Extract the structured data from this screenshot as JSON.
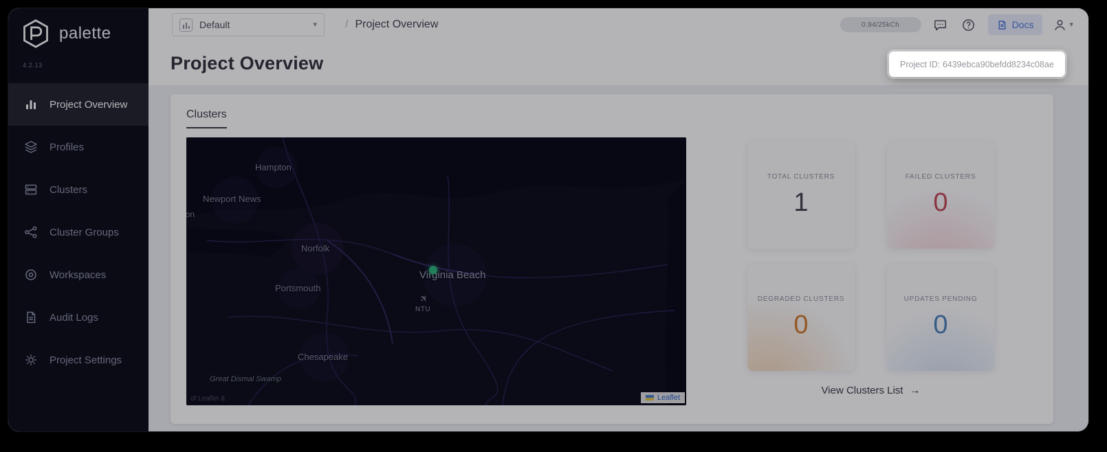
{
  "brand": {
    "name": "palette",
    "version": "4.2.13"
  },
  "icons": {
    "chevron_down": "▾",
    "slash": "/",
    "arrow_right": "→",
    "plane": "✈"
  },
  "header": {
    "project_selector": {
      "value": "Default"
    },
    "breadcrumb": "Project Overview",
    "usage_badge": "0.94/25kCh",
    "docs_label": "Docs"
  },
  "sidebar": {
    "items": [
      {
        "label": "Project Overview",
        "active": true
      },
      {
        "label": "Profiles",
        "active": false
      },
      {
        "label": "Clusters",
        "active": false
      },
      {
        "label": "Cluster Groups",
        "active": false
      },
      {
        "label": "Workspaces",
        "active": false
      },
      {
        "label": "Audit Logs",
        "active": false
      },
      {
        "label": "Project Settings",
        "active": false
      }
    ]
  },
  "page": {
    "title": "Project Overview",
    "project_id_tooltip": "Project ID: 6439ebca90befdd8234c08ae"
  },
  "clusters_card": {
    "tab": "Clusters",
    "view_list": "View Clusters List",
    "stats": [
      {
        "label": "TOTAL CLUSTERS",
        "value": "1",
        "color": "#454552"
      },
      {
        "label": "FAILED CLUSTERS",
        "value": "0",
        "color": "#c14b58"
      },
      {
        "label": "DEGRADED CLUSTERS",
        "value": "0",
        "color": "#d07c2e"
      },
      {
        "label": "UPDATES PENDING",
        "value": "0",
        "color": "#4e82b8"
      }
    ]
  },
  "map": {
    "labels": [
      {
        "name": "Hampton"
      },
      {
        "name": "Newport News"
      },
      {
        "name": "llton"
      },
      {
        "name": "Norfolk"
      },
      {
        "name": "Virginia Beach"
      },
      {
        "name": "Portsmouth"
      },
      {
        "name": "Chesapeake"
      },
      {
        "name": "Great Dismal Swamp"
      }
    ],
    "airport_code": "NTU",
    "marker_color": "#2eb47b",
    "attribution": "Leaflet",
    "attribution_partial": "of Leaflet &"
  }
}
